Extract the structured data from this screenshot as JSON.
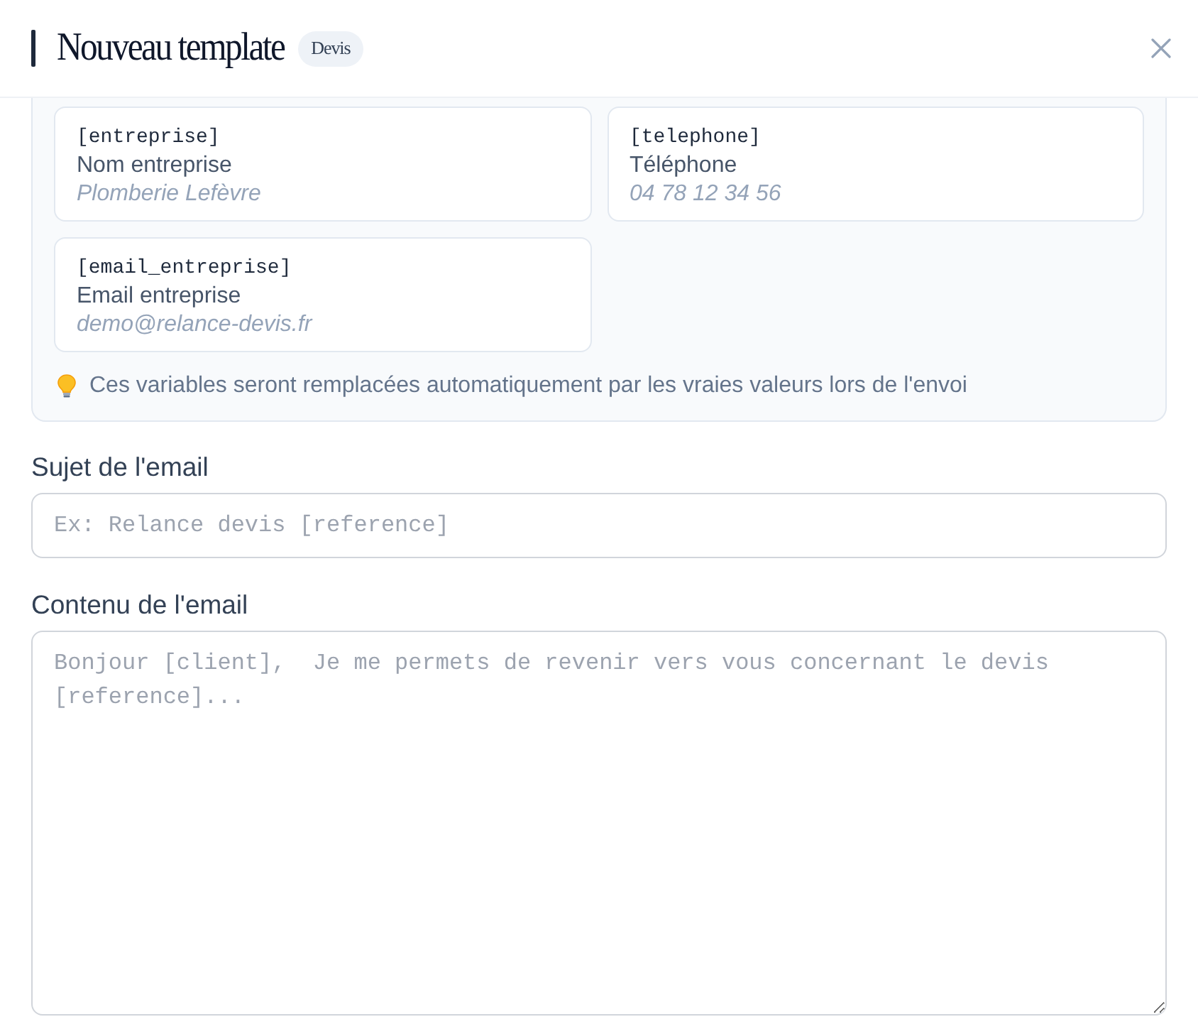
{
  "dialog": {
    "title": "Nouveau template",
    "badge": "Devis"
  },
  "variables": {
    "items": [
      {
        "code": "[entreprise]",
        "label": "Nom entreprise",
        "example": "Plomberie Lefèvre"
      },
      {
        "code": "[telephone]",
        "label": "Téléphone",
        "example": "04 78 12 34 56"
      },
      {
        "code": "[email_entreprise]",
        "label": "Email entreprise",
        "example": "demo@relance-devis.fr"
      }
    ],
    "tip": "Ces variables seront remplacées automatiquement par les vraies valeurs lors de l'envoi"
  },
  "fields": [
    {
      "kind": "input",
      "label": "Sujet de l'email",
      "placeholder": "Ex: Relance devis [reference]"
    },
    {
      "kind": "textarea",
      "label": "Contenu de l'email",
      "placeholder": "Bonjour [client],  Je me permets de revenir vers vous concernant le devis [reference]..."
    }
  ]
}
